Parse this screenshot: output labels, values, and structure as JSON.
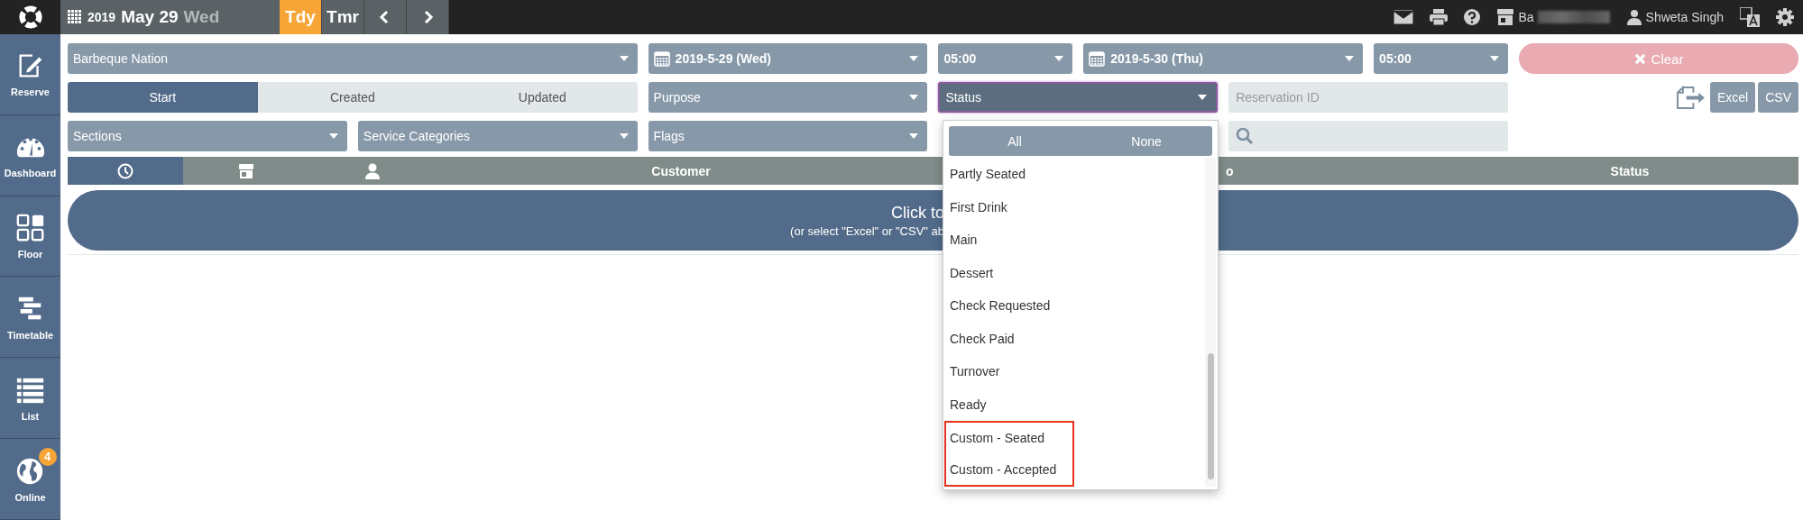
{
  "top_bar": {
    "date": {
      "year": "2019",
      "day": "May 29",
      "weekday": "Wed"
    },
    "quick_days": [
      {
        "label": "Tdy",
        "selected": true
      },
      {
        "label": "Tmr",
        "selected": false
      }
    ],
    "account": {
      "store": "Ba",
      "user": "Shweta Singh"
    }
  },
  "sidebar": {
    "items": [
      {
        "label": "Reserve"
      },
      {
        "label": "Dashboard"
      },
      {
        "label": "Floor"
      },
      {
        "label": "Timetable"
      },
      {
        "label": "List"
      },
      {
        "label": "Online",
        "badge": "4"
      }
    ]
  },
  "filters": {
    "venue": "Barbeque Nation",
    "start_date": "2019-5-29 (Wed)",
    "start_time": "05:00",
    "end_date": "2019-5-30 (Thu)",
    "end_time": "05:00",
    "clear": {
      "label": "Clear",
      "disabled": true
    },
    "date_mode": [
      {
        "label": "Start",
        "selected": true
      },
      {
        "label": "Created",
        "selected": false
      },
      {
        "label": "Updated",
        "selected": false
      }
    ],
    "purpose": "Purpose",
    "status": {
      "label": "Status",
      "expanded": true
    },
    "reservation_id": {
      "placeholder": "Reservation ID"
    },
    "export_buttons": [
      "Excel",
      "CSV"
    ],
    "sections": "Sections",
    "service_categories": "Service Categories",
    "flags": "Flags"
  },
  "table": {
    "columns": [
      {
        "kind": "icon",
        "selected": true
      },
      {
        "kind": "icon",
        "selected": false
      },
      {
        "kind": "icon",
        "selected": false
      },
      {
        "kind": "text",
        "label": "Customer",
        "selected": false
      },
      {
        "kind": "text",
        "label": "o",
        "selected": false
      },
      {
        "kind": "text",
        "label": "Status",
        "selected": false
      }
    ],
    "prompt": [
      "Click to",
      "(or select \"Excel\" or \"CSV\" ab"
    ]
  },
  "status_menu": {
    "actions": [
      "All",
      "None"
    ],
    "options": [
      {
        "label": "Partly Seated",
        "highlighted": false
      },
      {
        "label": "First Drink",
        "highlighted": false
      },
      {
        "label": "Main",
        "highlighted": false
      },
      {
        "label": "Dessert",
        "highlighted": false
      },
      {
        "label": "Check Requested",
        "highlighted": false
      },
      {
        "label": "Check Paid",
        "highlighted": false
      },
      {
        "label": "Turnover",
        "highlighted": false
      },
      {
        "label": "Ready",
        "highlighted": false
      },
      {
        "label": "Custom - Seated",
        "highlighted": true
      },
      {
        "label": "Custom - Accepted",
        "highlighted": true
      }
    ]
  }
}
